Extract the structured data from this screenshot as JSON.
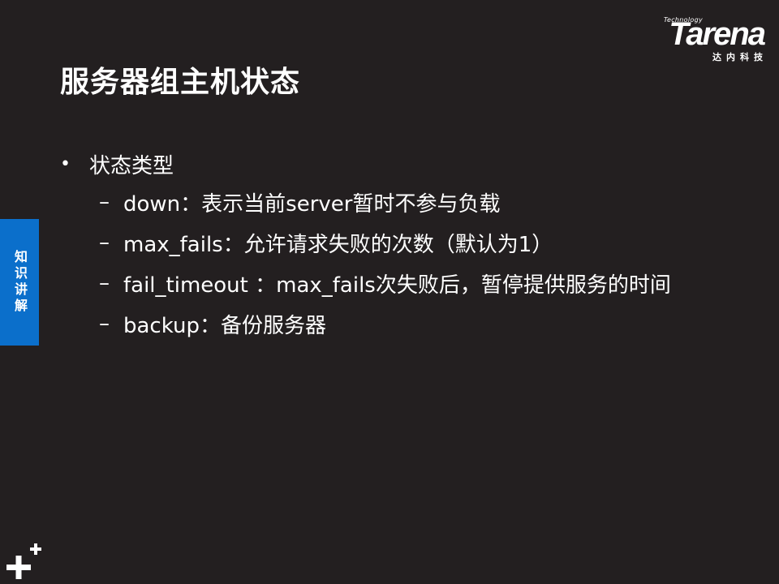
{
  "logo": {
    "tagline": "Technology",
    "wordmark": "Tarena",
    "chinese": "达内科技"
  },
  "slide": {
    "title": "服务器组主机状态",
    "side_tab": "知识讲解",
    "bullet_symbol": "•",
    "dash_symbol": "–",
    "items": [
      {
        "text": "状态类型",
        "subitems": [
          "down：表示当前server暂时不参与负载",
          "max_fails：允许请求失败的次数（默认为1）",
          "fail_timeout ：max_fails次失败后，暂停提供服务的时间",
          "backup：备份服务器"
        ]
      }
    ]
  },
  "colors": {
    "background": "#231f20",
    "accent": "#0b6fcb",
    "text": "#ffffff"
  }
}
